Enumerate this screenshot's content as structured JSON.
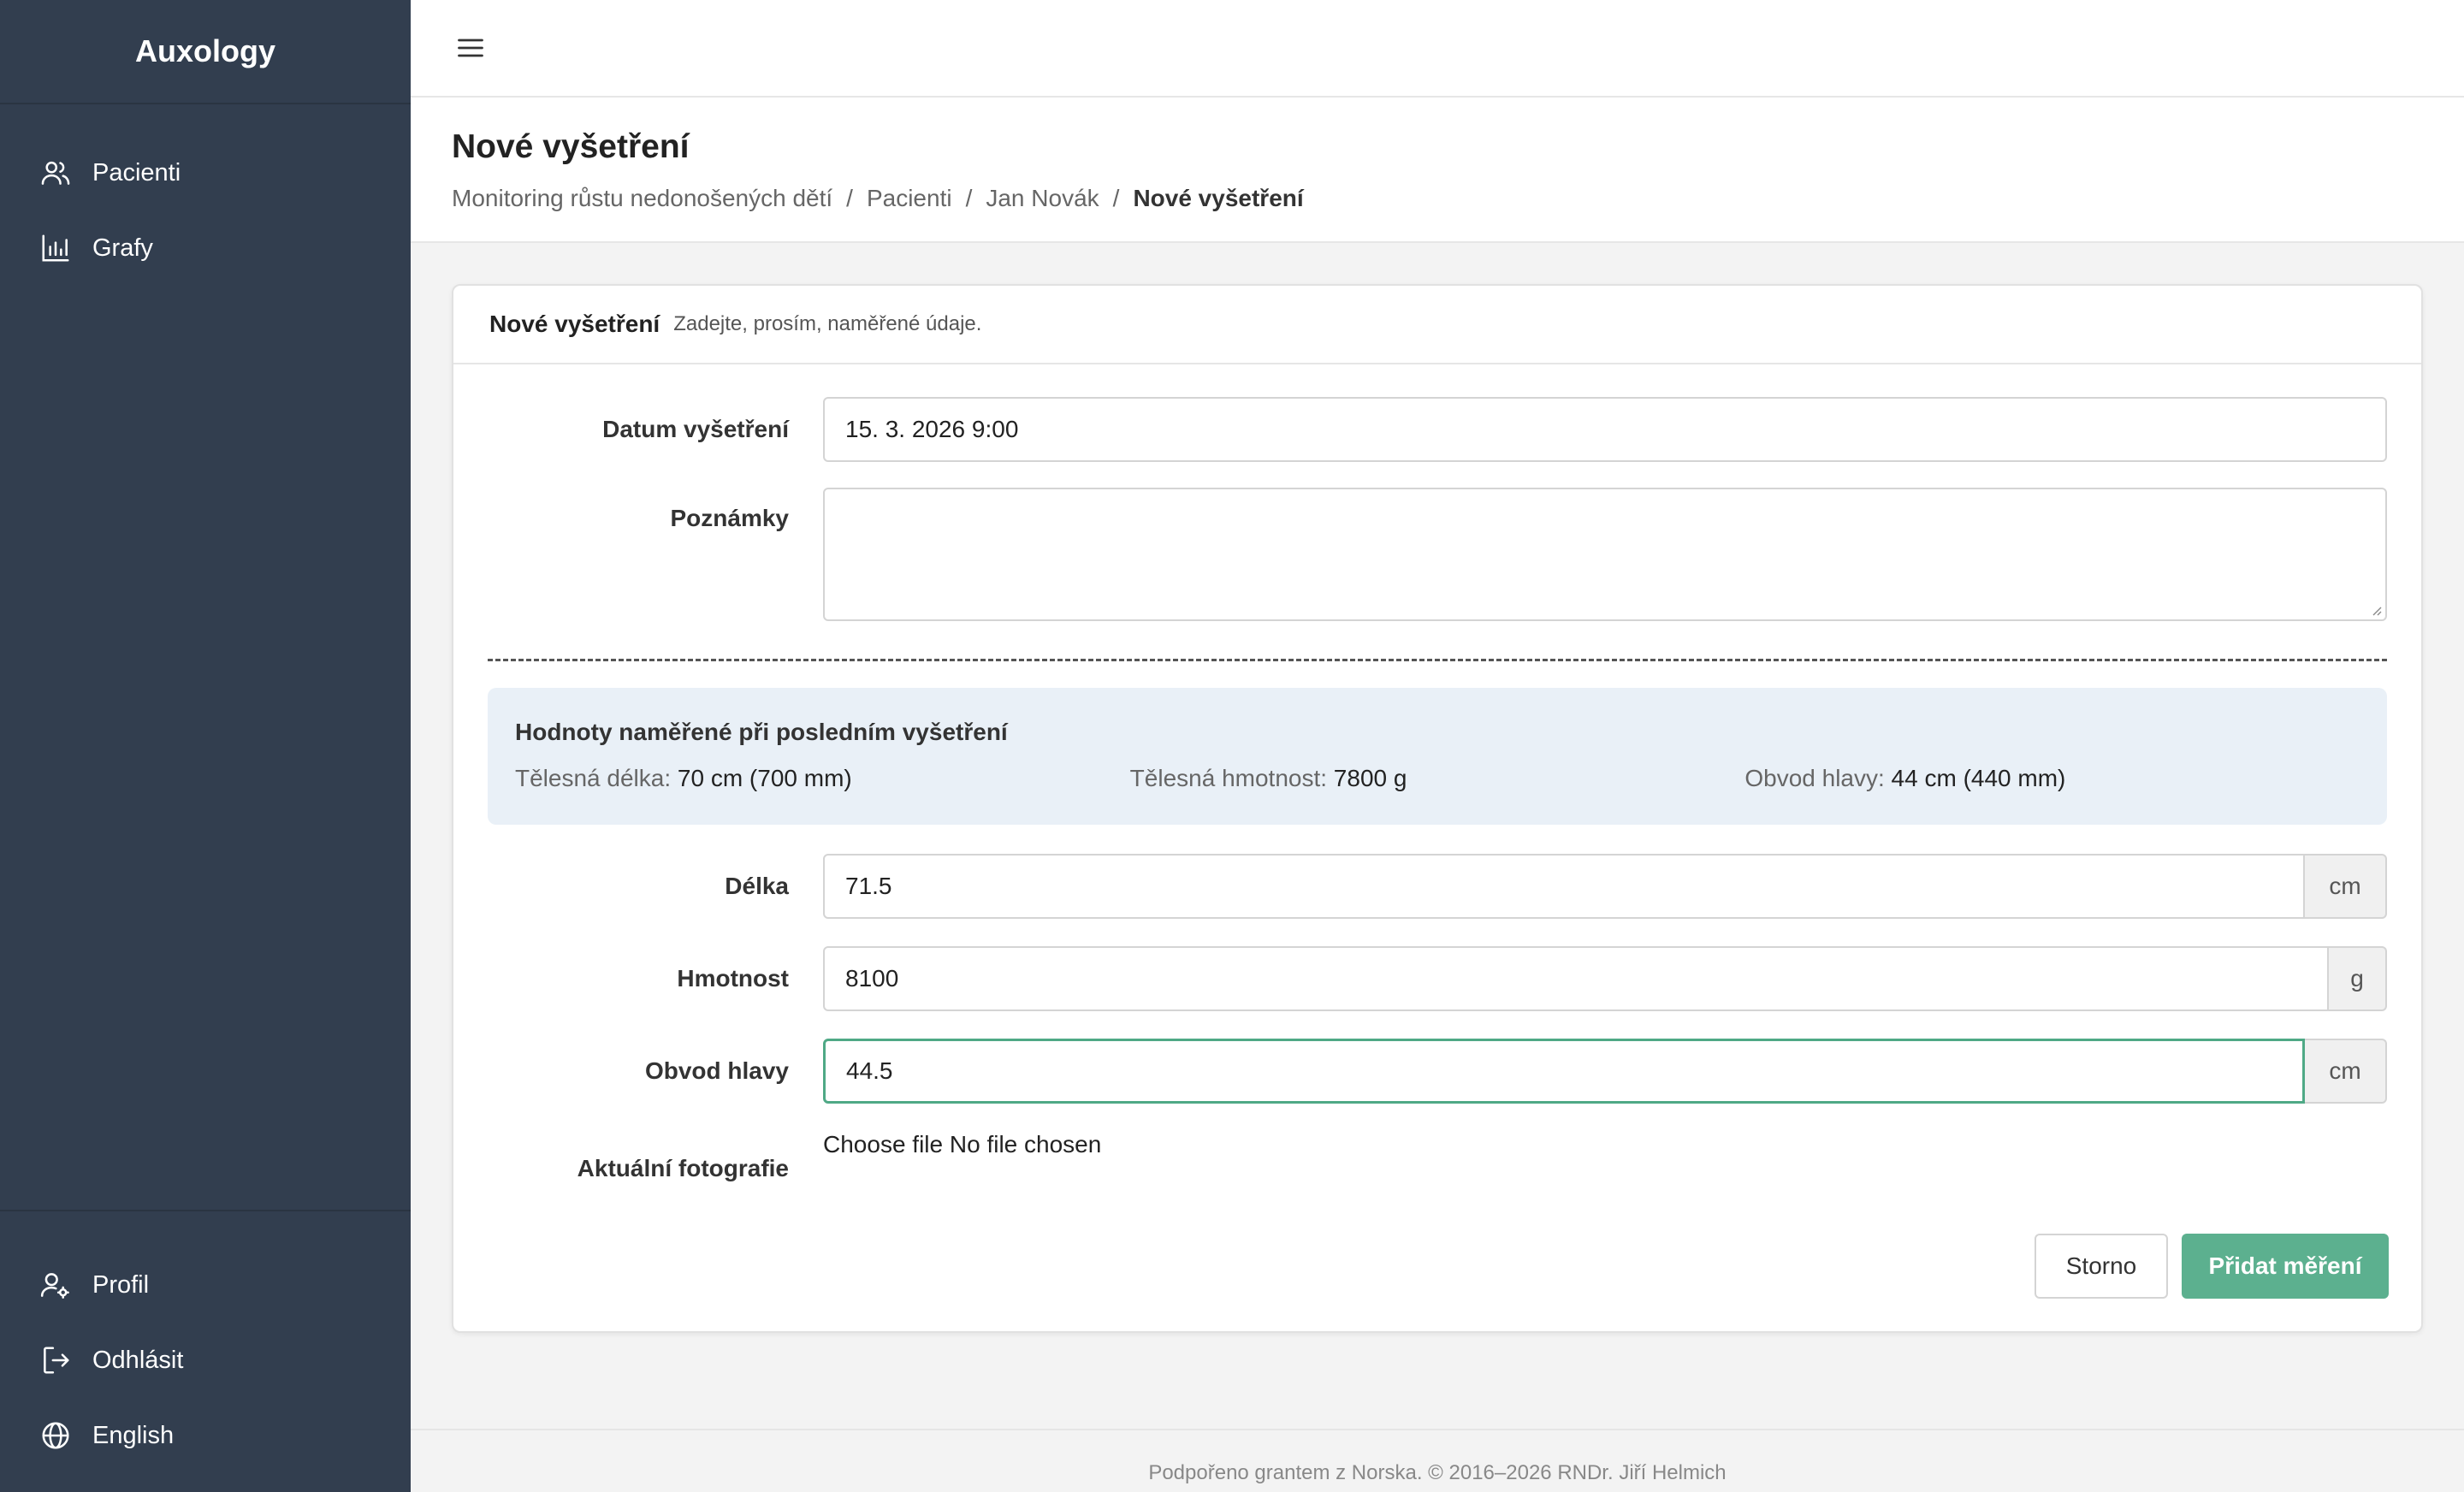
{
  "sidebar": {
    "brand": "Auxology",
    "top_items": [
      {
        "label": "Pacienti",
        "icon": "users-icon"
      },
      {
        "label": "Grafy",
        "icon": "bar-chart-icon"
      }
    ],
    "bottom_items": [
      {
        "label": "Profil",
        "icon": "user-settings-icon"
      },
      {
        "label": "Odhlásit",
        "icon": "logout-icon"
      },
      {
        "label": "English",
        "icon": "globe-icon"
      }
    ]
  },
  "header": {
    "title": "Nové vyšetření",
    "breadcrumb": [
      "Monitoring růstu nedonošených dětí",
      "Pacienti",
      "Jan Novák",
      "Nové vyšetření"
    ],
    "separator": "/"
  },
  "card": {
    "title": "Nové vyšetření",
    "subtitle": "Zadejte, prosím, naměřené údaje.",
    "date_label": "Datum vyšetření",
    "date_value": "15. 3. 2026 9:00",
    "notes_label": "Poznámky",
    "notes_value": "",
    "last_values": {
      "title": "Hodnoty naměřené při posledním vyšetření",
      "items": [
        {
          "label": "Tělesná délka:",
          "value": "70 cm (700 mm)"
        },
        {
          "label": "Tělesná hmotnost:",
          "value": "7800 g"
        },
        {
          "label": "Obvod hlavy:",
          "value": "44 cm (440 mm)"
        }
      ]
    },
    "length_label": "Délka",
    "length_value": "71.5",
    "length_unit": "cm",
    "weight_label": "Hmotnost",
    "weight_value": "8100",
    "weight_unit": "g",
    "head_label": "Obvod hlavy",
    "head_value": "44.5",
    "head_unit": "cm",
    "photo_label": "Aktuální fotografie",
    "file_button": "Choose file",
    "file_status": "No file chosen",
    "cancel_label": "Storno",
    "submit_label": "Přidat měření"
  },
  "footer": {
    "text": "Podpořeno grantem z Norska. © 2016–2026 RNDr. Jiří Helmich"
  },
  "colors": {
    "sidebar_bg": "#323e4f",
    "primary_button": "#5cb08f",
    "focus_border": "#4fa986",
    "info_box_bg": "#e9f0f7"
  }
}
